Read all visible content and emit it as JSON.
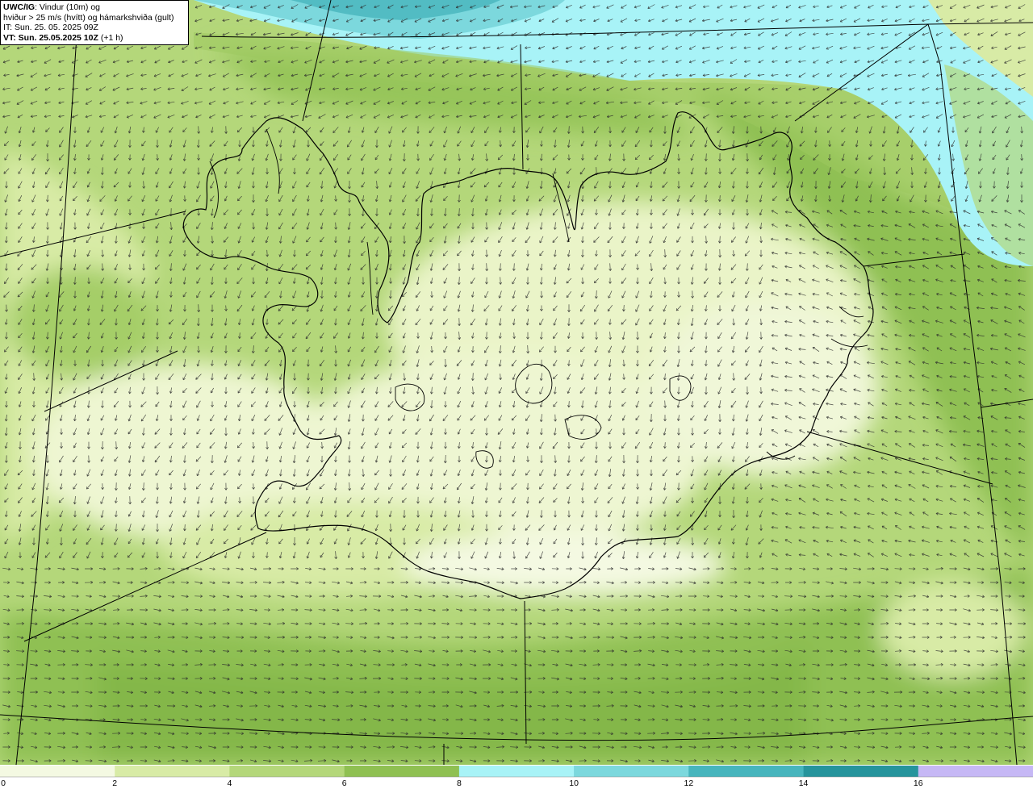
{
  "info": {
    "model": "UWC/IG",
    "title_rest": ": Vindur (10m) og",
    "line2": "hviður > 25 m/s (hvítt) og hámarkshviða (gult)",
    "it": "IT: Sun. 25. 05. 2025 09Z",
    "vt": "VT: Sun. 25.05.2025 10Z",
    "vt_offset": " (+1 h)"
  },
  "legend": {
    "labels": [
      "0",
      "2",
      "4",
      "6",
      "8",
      "10",
      "12",
      "14",
      "16"
    ],
    "colors": [
      "#f4f9e2",
      "#d8eba6",
      "#b4d77a",
      "#8fc052",
      "#a8f3f7",
      "#7cd8dd",
      "#47b5bd",
      "#26949c",
      "#c6b8f5"
    ]
  },
  "map_colors": {
    "calm": "#f4f9e2",
    "light": "#d8eba6",
    "moderate": "#b4d77a",
    "fresh": "#8fc052",
    "sea_light": "#a8f3f7",
    "sea_mid": "#7cd8dd",
    "sea_deep": "#47b5bd"
  }
}
